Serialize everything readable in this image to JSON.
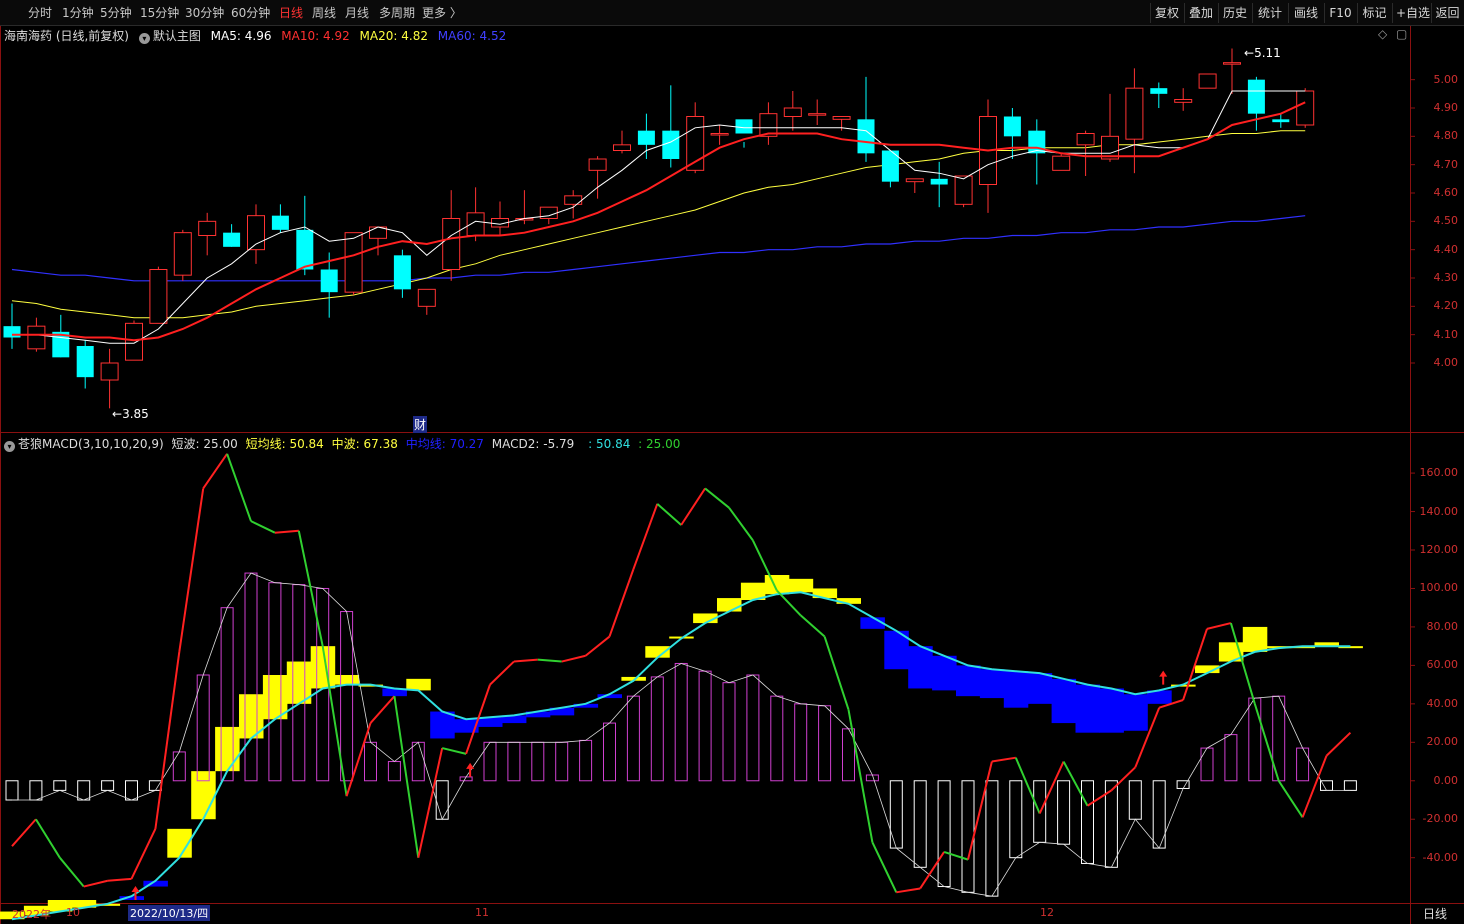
{
  "toolbar": {
    "periods": [
      "分时",
      "1分钟",
      "5分钟",
      "15分钟",
      "30分钟",
      "60分钟",
      "日线",
      "周线",
      "月线",
      "多周期",
      "更多 〉"
    ],
    "active_period": "日线",
    "tools": [
      "复权",
      "叠加",
      "历史",
      "统计",
      "画线",
      "F10",
      "标记",
      "+自选",
      "返回"
    ]
  },
  "main_legend": {
    "stock": "海南海药 (日线,前复权)",
    "template": "默认主图",
    "ma5_label": "MA5:",
    "ma5_value": "4.96",
    "ma10_label": "MA10:",
    "ma10_value": "4.92",
    "ma20_label": "MA20:",
    "ma20_value": "4.82",
    "ma60_label": "MA60:",
    "ma60_value": "4.52"
  },
  "sub_legend": {
    "name": "苍狼MACD(3,10,10,20,9)",
    "short_label": "短波:",
    "short_value": "25.00",
    "shortavg_label": "短均线:",
    "shortavg_value": "50.84",
    "mid_label": "中波:",
    "mid_value": "67.38",
    "midavg_label": "中均线:",
    "midavg_value": "70.27",
    "macd2_label": "MACD2:",
    "macd2_value": "-5.79",
    "extra1": ": 50.84",
    "extra2": ": 25.00"
  },
  "annotations": {
    "high": "5.11",
    "low": "3.85",
    "cai": "财"
  },
  "price_axis": [
    "5.00",
    "4.90",
    "4.80",
    "4.70",
    "4.60",
    "4.50",
    "4.40",
    "4.30",
    "4.20",
    "4.10",
    "4.00"
  ],
  "macd_axis": [
    "160.00",
    "140.00",
    "120.00",
    "100.00",
    "80.00",
    "60.00",
    "40.00",
    "20.00",
    "0.00",
    "-20.00",
    "-40.00"
  ],
  "date_axis": {
    "year": "2022年",
    "m10": "10",
    "cursor": "2022/10/13/四",
    "m11": "11",
    "m12": "12",
    "period": "日线"
  },
  "colors": {
    "up": "#ff3232",
    "down": "#00ffff",
    "ma5": "#ffffff",
    "ma10": "#ff2020",
    "ma20": "#ffff40",
    "ma60": "#3030ff",
    "yellow": "#ffff00",
    "blue": "#0000ff",
    "cyan": "#30e0e0",
    "green": "#30d030",
    "magenta": "#d040d0",
    "red": "#ff2020"
  },
  "chart_data": [
    {
      "type": "candlestick",
      "title": "海南海药 (日线,前复权)",
      "ylim": [
        3.82,
        5.14
      ],
      "ohlc": [
        [
          4.13,
          4.21,
          4.05,
          4.09
        ],
        [
          4.05,
          4.16,
          4.04,
          4.13
        ],
        [
          4.11,
          4.17,
          4.02,
          4.02
        ],
        [
          4.06,
          4.08,
          3.91,
          3.95
        ],
        [
          3.94,
          4.05,
          3.84,
          4.0
        ],
        [
          4.01,
          4.15,
          4.01,
          4.14
        ],
        [
          4.14,
          4.34,
          4.14,
          4.33
        ],
        [
          4.31,
          4.47,
          4.29,
          4.46
        ],
        [
          4.45,
          4.53,
          4.38,
          4.5
        ],
        [
          4.46,
          4.49,
          4.41,
          4.41
        ],
        [
          4.4,
          4.56,
          4.35,
          4.52
        ],
        [
          4.52,
          4.56,
          4.46,
          4.47
        ],
        [
          4.47,
          4.59,
          4.31,
          4.33
        ],
        [
          4.33,
          4.39,
          4.16,
          4.25
        ],
        [
          4.25,
          4.44,
          4.24,
          4.46
        ],
        [
          4.44,
          4.47,
          4.38,
          4.48
        ],
        [
          4.38,
          4.4,
          4.23,
          4.26
        ],
        [
          4.2,
          4.24,
          4.17,
          4.26
        ],
        [
          4.33,
          4.61,
          4.29,
          4.51
        ],
        [
          4.45,
          4.62,
          4.43,
          4.53
        ],
        [
          4.48,
          4.57,
          4.45,
          4.51
        ],
        [
          4.51,
          4.61,
          4.49,
          4.51
        ],
        [
          4.51,
          4.55,
          4.49,
          4.55
        ],
        [
          4.56,
          4.61,
          4.51,
          4.59
        ],
        [
          4.68,
          4.73,
          4.58,
          4.72
        ],
        [
          4.75,
          4.82,
          4.74,
          4.77
        ],
        [
          4.82,
          4.88,
          4.72,
          4.77
        ],
        [
          4.82,
          4.98,
          4.69,
          4.72
        ],
        [
          4.68,
          4.92,
          4.67,
          4.87
        ],
        [
          4.81,
          4.84,
          4.77,
          4.81
        ],
        [
          4.86,
          4.78,
          4.76,
          4.81
        ],
        [
          4.8,
          4.92,
          4.77,
          4.88
        ],
        [
          4.87,
          4.96,
          4.82,
          4.9
        ],
        [
          4.88,
          4.93,
          4.84,
          4.88
        ],
        [
          4.86,
          4.87,
          4.82,
          4.87
        ],
        [
          4.86,
          5.01,
          4.71,
          4.74
        ],
        [
          4.75,
          4.75,
          4.62,
          4.64
        ],
        [
          4.64,
          4.65,
          4.6,
          4.65
        ],
        [
          4.65,
          4.71,
          4.55,
          4.63
        ],
        [
          4.56,
          4.66,
          4.55,
          4.66
        ],
        [
          4.63,
          4.93,
          4.53,
          4.87
        ],
        [
          4.87,
          4.9,
          4.72,
          4.8
        ],
        [
          4.82,
          4.86,
          4.63,
          4.74
        ],
        [
          4.68,
          4.74,
          4.68,
          4.73
        ],
        [
          4.77,
          4.82,
          4.66,
          4.81
        ],
        [
          4.72,
          4.95,
          4.71,
          4.8
        ],
        [
          4.79,
          5.04,
          4.67,
          4.97
        ],
        [
          4.97,
          4.99,
          4.9,
          4.95
        ],
        [
          4.92,
          4.97,
          4.89,
          4.93
        ],
        [
          4.97,
          5.02,
          4.97,
          5.02
        ],
        [
          5.06,
          5.11,
          4.95,
          5.06
        ],
        [
          5.0,
          5.01,
          4.82,
          4.88
        ],
        [
          4.86,
          4.88,
          4.83,
          4.85
        ],
        [
          4.84,
          4.97,
          4.83,
          4.96
        ]
      ],
      "ma5": [
        4.1,
        4.1,
        4.09,
        4.08,
        4.07,
        4.07,
        4.12,
        4.21,
        4.3,
        4.35,
        4.42,
        4.46,
        4.48,
        4.43,
        4.44,
        4.48,
        4.46,
        4.38,
        4.45,
        4.5,
        4.49,
        4.51,
        4.52,
        4.55,
        4.62,
        4.68,
        4.75,
        4.78,
        4.83,
        4.84,
        4.83,
        4.83,
        4.83,
        4.83,
        4.83,
        4.82,
        4.75,
        4.68,
        4.67,
        4.65,
        4.7,
        4.73,
        4.75,
        4.74,
        4.74,
        4.74,
        4.77,
        4.76,
        4.76,
        4.79,
        4.96,
        4.96,
        4.96,
        4.96
      ],
      "ma10": [
        4.1,
        4.1,
        4.1,
        4.09,
        4.09,
        4.08,
        4.09,
        4.12,
        4.16,
        4.21,
        4.26,
        4.3,
        4.34,
        4.36,
        4.38,
        4.41,
        4.43,
        4.42,
        4.44,
        4.45,
        4.45,
        4.46,
        4.48,
        4.5,
        4.53,
        4.57,
        4.61,
        4.66,
        4.71,
        4.76,
        4.79,
        4.81,
        4.81,
        4.81,
        4.79,
        4.78,
        4.77,
        4.77,
        4.77,
        4.76,
        4.75,
        4.76,
        4.76,
        4.74,
        4.73,
        4.73,
        4.73,
        4.73,
        4.76,
        4.79,
        4.84,
        4.86,
        4.88,
        4.92
      ],
      "ma20": [
        4.22,
        4.21,
        4.19,
        4.18,
        4.17,
        4.16,
        4.16,
        4.16,
        4.17,
        4.18,
        4.2,
        4.21,
        4.22,
        4.23,
        4.24,
        4.26,
        4.28,
        4.3,
        4.33,
        4.35,
        4.38,
        4.4,
        4.42,
        4.44,
        4.46,
        4.48,
        4.5,
        4.52,
        4.54,
        4.57,
        4.6,
        4.62,
        4.63,
        4.65,
        4.67,
        4.69,
        4.7,
        4.71,
        4.72,
        4.74,
        4.75,
        4.75,
        4.76,
        4.76,
        4.76,
        4.77,
        4.77,
        4.78,
        4.79,
        4.8,
        4.81,
        4.81,
        4.82,
        4.82
      ],
      "ma60": [
        4.33,
        4.32,
        4.31,
        4.31,
        4.3,
        4.29,
        4.29,
        4.29,
        4.29,
        4.29,
        4.29,
        4.29,
        4.29,
        4.29,
        4.29,
        4.29,
        4.29,
        4.3,
        4.3,
        4.31,
        4.31,
        4.32,
        4.32,
        4.33,
        4.34,
        4.35,
        4.36,
        4.37,
        4.38,
        4.39,
        4.39,
        4.4,
        4.4,
        4.41,
        4.41,
        4.42,
        4.42,
        4.43,
        4.43,
        4.44,
        4.44,
        4.45,
        4.45,
        4.46,
        4.46,
        4.47,
        4.47,
        4.48,
        4.48,
        4.49,
        4.5,
        4.5,
        4.51,
        4.52
      ]
    },
    {
      "type": "line",
      "title": "苍狼MACD(3,10,10,20,9)",
      "ylim": [
        -62,
        172
      ],
      "series": [
        {
          "name": "短波",
          "values": [
            -34,
            -20,
            -40,
            -55,
            -52,
            -51,
            -25,
            67,
            152,
            170,
            135,
            129,
            130,
            70,
            -8,
            30,
            44,
            -40,
            17,
            14,
            50,
            62,
            63,
            62,
            65,
            75,
            110,
            144,
            133,
            152,
            142,
            125,
            99,
            86,
            75,
            37,
            -32,
            -58,
            -56,
            -37,
            -41,
            10,
            12,
            -17,
            10,
            -13,
            -5,
            7,
            38,
            42,
            79,
            82,
            40,
            0,
            -19,
            13,
            25
          ]
        },
        {
          "name": "短均线",
          "values": [
            -58,
            -55,
            -50,
            -46,
            -50,
            -49,
            -42,
            -14,
            25,
            52,
            68,
            77,
            84,
            79,
            65,
            57,
            55,
            50,
            35,
            28,
            32,
            38,
            41,
            44,
            48,
            54,
            64,
            80,
            92,
            99,
            106,
            111,
            108,
            102,
            99,
            83,
            71,
            58,
            42,
            36,
            15,
            13,
            15,
            18,
            18,
            14,
            16,
            12,
            18,
            30,
            42,
            55,
            61,
            62,
            54,
            49,
            50
          ]
        },
        {
          "name": "中波",
          "values": [
            -68,
            -65,
            -62,
            -62,
            -64,
            -62,
            -55,
            -25,
            5,
            28,
            45,
            55,
            62,
            70,
            55,
            50,
            44,
            53,
            22,
            25,
            28,
            30,
            33,
            34,
            38,
            43,
            54,
            70,
            75,
            87,
            95,
            103,
            107,
            105,
            100,
            95,
            79,
            58,
            48,
            47,
            44,
            43,
            38,
            40,
            30,
            25,
            25,
            26,
            40,
            50,
            60,
            72,
            80,
            70,
            70,
            72,
            70
          ]
        },
        {
          "name": "中均线",
          "values": [
            -72,
            -70,
            -68,
            -66,
            -64,
            -60,
            -52,
            -40,
            -20,
            5,
            22,
            32,
            40,
            48,
            50,
            50,
            48,
            47,
            36,
            32,
            33,
            34,
            36,
            38,
            40,
            45,
            52,
            64,
            74,
            82,
            88,
            94,
            97,
            98,
            95,
            92,
            85,
            78,
            70,
            65,
            60,
            58,
            57,
            56,
            53,
            50,
            48,
            45,
            47,
            50,
            56,
            62,
            67,
            69,
            70,
            70,
            70
          ]
        },
        {
          "name": "MACD2",
          "values": [
            -10,
            -10,
            -5,
            -10,
            -5,
            -10,
            -5,
            15,
            55,
            90,
            108,
            103,
            102,
            100,
            88,
            20,
            10,
            20,
            -20,
            2,
            20,
            20,
            20,
            20,
            21,
            30,
            44,
            54,
            61,
            57,
            51,
            55,
            44,
            40,
            39,
            27,
            3,
            -35,
            -45,
            -55,
            -58,
            -60,
            -40,
            -32,
            -33,
            -43,
            -45,
            -20,
            -35,
            -4,
            17,
            24,
            43,
            44,
            17,
            -5,
            -5
          ]
        }
      ]
    }
  ]
}
